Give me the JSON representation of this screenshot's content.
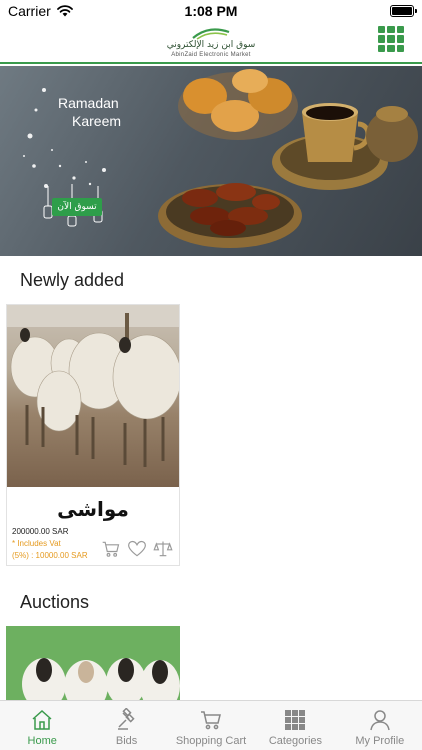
{
  "status_bar": {
    "carrier": "Carrier",
    "time": "1:08 PM",
    "icons": [
      "wifi-icon",
      "battery-icon"
    ]
  },
  "header": {
    "logo_ar": "سوق ابن زيد الإلكتروني",
    "logo_en": "AbinZaid Electronic Market",
    "menu_icon": "grid-icon",
    "accent_color": "#3a9a4c"
  },
  "banner": {
    "line1": "Ramadan",
    "line2": "Kareem",
    "button_label": "تسوق الآن"
  },
  "sections": {
    "newly_added": "Newly added",
    "auctions": "Auctions"
  },
  "product": {
    "name": "مواشى",
    "price": "200000.00 SAR",
    "vat_line1": "* Includes Vat",
    "vat_line2": "(5%) : 10000.00 SAR",
    "price_note_color": "#e59a1f",
    "actions": [
      "cart-icon",
      "heart-icon",
      "compare-scale-icon"
    ]
  },
  "tabs": [
    {
      "label": "Home",
      "icon": "home-icon",
      "active": true
    },
    {
      "label": "Bids",
      "icon": "gavel-icon",
      "active": false
    },
    {
      "label": "Shopping Cart",
      "icon": "cart-icon",
      "active": false
    },
    {
      "label": "Categories",
      "icon": "grid-icon",
      "active": false
    },
    {
      "label": "My Profile",
      "icon": "user-icon",
      "active": false
    }
  ]
}
